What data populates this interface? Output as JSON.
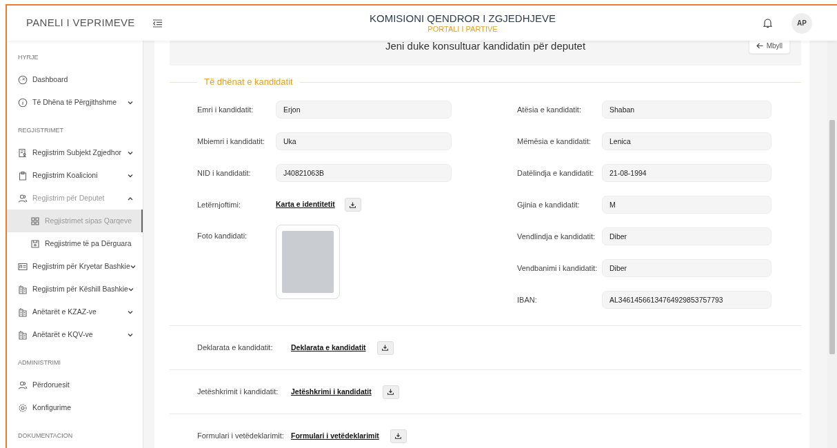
{
  "header": {
    "brand": "PANELI I VEPRIMEVE",
    "title": "KOMISIONI QENDROR I ZGJEDHJEVE",
    "subtitle": "PORTALI I PARTIVE",
    "avatar": "AP"
  },
  "sidebar": {
    "sections": [
      {
        "heading": "HYRJE",
        "items": [
          {
            "label": "Dashboard"
          },
          {
            "label": "Të Dhëna të Përgjithshme",
            "expanded": false
          }
        ]
      },
      {
        "heading": "REGJISTRIMET",
        "items": [
          {
            "label": "Regjistrim Subjekt Zgjedhor",
            "expanded": false
          },
          {
            "label": "Regjistrim Koalicioni",
            "expanded": false
          },
          {
            "label": "Regjistrim për Deputet",
            "expanded": true,
            "children": [
              {
                "label": "Regjistrimet sipas Qarqeve",
                "selected": true
              },
              {
                "label": "Regjistrime të pa Dërguara",
                "selected": false
              }
            ]
          },
          {
            "label": "Regjistrim për Kryetar Bashkie",
            "expanded": false
          },
          {
            "label": "Regjistrim për Këshill Bashkie",
            "expanded": false
          },
          {
            "label": "Anëtarët e KZAZ-ve",
            "expanded": false
          },
          {
            "label": "Anëtarët e KQV-ve",
            "expanded": false
          }
        ]
      },
      {
        "heading": "ADMINISTRIMI",
        "items": [
          {
            "label": "Përdoruesit"
          },
          {
            "label": "Konfigurime"
          }
        ]
      },
      {
        "heading": "DOKUMENTACION"
      }
    ]
  },
  "banner": {
    "text": "Jeni duke konsultuar kandidatin për deputet",
    "close_button": "Mbyll"
  },
  "section_title": "Të dhënat e kandidatit",
  "left_fields": [
    {
      "kind": "text",
      "label": "Emri i kandidatit:",
      "value": "Erjon"
    },
    {
      "kind": "text",
      "label": "Mbiemri i kandidatit:",
      "value": "Uka"
    },
    {
      "kind": "text",
      "label": "NID i kandidatit:",
      "value": "J40821063B"
    },
    {
      "kind": "file",
      "label": "Letërnjoftimi:",
      "link": "Karta e identitetit"
    },
    {
      "kind": "photo",
      "label": "Foto kandidati:"
    }
  ],
  "right_fields": [
    {
      "label": "Atësia e kandidatit:",
      "value": "Shaban"
    },
    {
      "label": "Mëmësia e kandidatit:",
      "value": "Lenica"
    },
    {
      "label": "Datëlindja e kandidatit:",
      "value": "21-08-1994"
    },
    {
      "label": "Gjinia e kandidatit:",
      "value": "M"
    },
    {
      "label": "Vendlindja e kandidatit:",
      "value": "Diber"
    },
    {
      "label": "Vendbanimi i kandidatit:",
      "value": "Diber"
    },
    {
      "label": "IBAN:",
      "value": "AL34614566134764929853757793"
    }
  ],
  "documents": [
    {
      "label": "Deklarata e kandidatit:",
      "link": "Deklarata e kandidatit"
    },
    {
      "label": "Jetëshkrimit i kandidatit:",
      "link": "Jetëshkrimi i kandidatit"
    },
    {
      "label": "Formulari i vetëdeklarimit:",
      "link": "Formulari i vetëdeklarimit"
    }
  ]
}
